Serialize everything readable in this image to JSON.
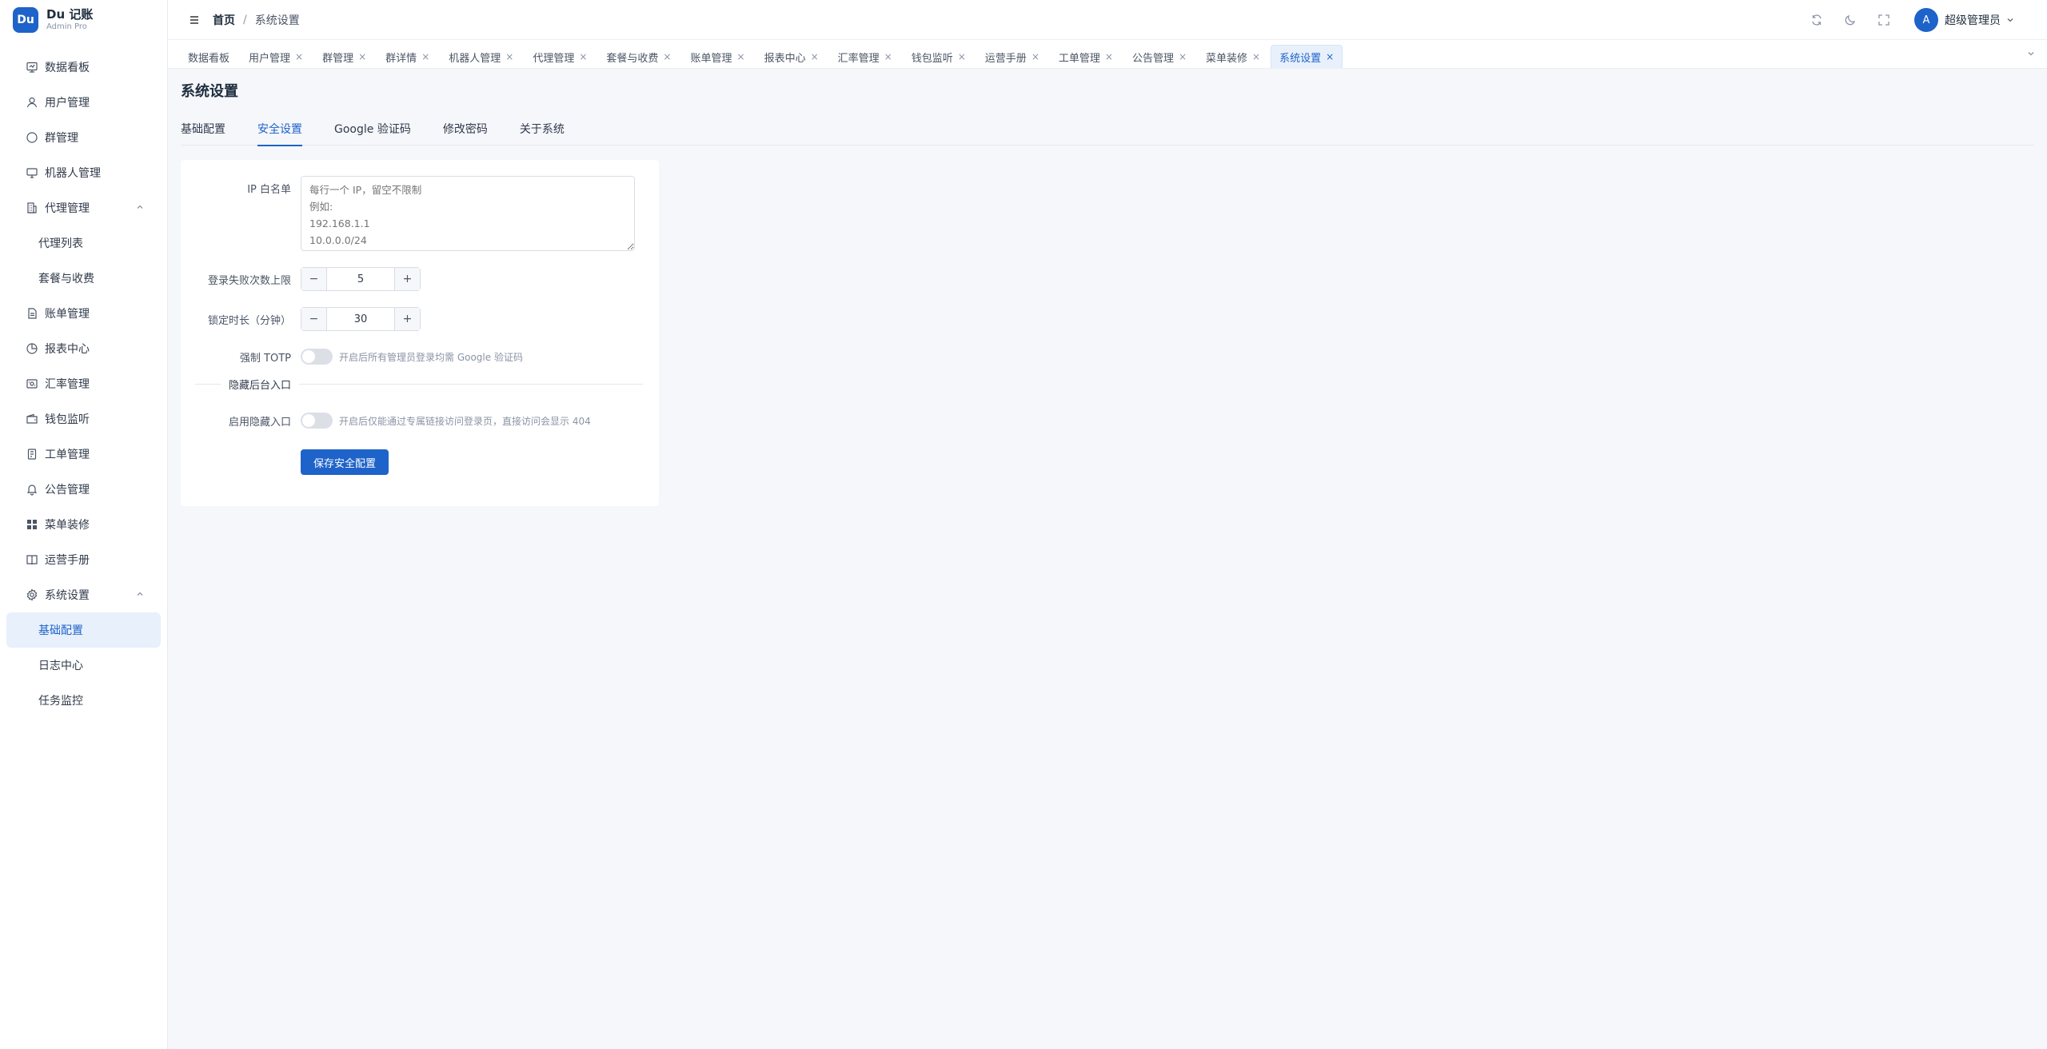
{
  "brand": {
    "logo": "Du",
    "name": "Du 记账",
    "sub": "Admin Pro"
  },
  "sidebar": {
    "items": [
      {
        "label": "数据看板",
        "icon": "dashboard-icon"
      },
      {
        "label": "用户管理",
        "icon": "user-icon"
      },
      {
        "label": "群管理",
        "icon": "chat-icon"
      },
      {
        "label": "机器人管理",
        "icon": "monitor-icon"
      },
      {
        "label": "代理管理",
        "icon": "building-icon",
        "expanded": true
      },
      {
        "label": "代理列表",
        "sub": true
      },
      {
        "label": "套餐与收费",
        "sub": true
      },
      {
        "label": "账单管理",
        "icon": "document-icon"
      },
      {
        "label": "报表中心",
        "icon": "pie-chart-icon"
      },
      {
        "label": "汇率管理",
        "icon": "exchange-icon"
      },
      {
        "label": "钱包监听",
        "icon": "wallet-icon"
      },
      {
        "label": "工单管理",
        "icon": "ticket-icon"
      },
      {
        "label": "公告管理",
        "icon": "bell-icon"
      },
      {
        "label": "菜单装修",
        "icon": "grid-icon"
      },
      {
        "label": "运营手册",
        "icon": "book-icon"
      },
      {
        "label": "系统设置",
        "icon": "gear-icon",
        "expanded": true
      },
      {
        "label": "基础配置",
        "sub": true,
        "active": true
      },
      {
        "label": "日志中心",
        "sub": true
      },
      {
        "label": "任务监控",
        "sub": true
      }
    ]
  },
  "header": {
    "breadcrumb_home": "首页",
    "breadcrumb_sep": "/",
    "breadcrumb_current": "系统设置",
    "avatar_letter": "A",
    "username": "超级管理员"
  },
  "tabs": [
    {
      "label": "数据看板",
      "closable": false
    },
    {
      "label": "用户管理",
      "closable": true
    },
    {
      "label": "群管理",
      "closable": true
    },
    {
      "label": "群详情",
      "closable": true
    },
    {
      "label": "机器人管理",
      "closable": true
    },
    {
      "label": "代理管理",
      "closable": true
    },
    {
      "label": "套餐与收费",
      "closable": true
    },
    {
      "label": "账单管理",
      "closable": true
    },
    {
      "label": "报表中心",
      "closable": true
    },
    {
      "label": "汇率管理",
      "closable": true
    },
    {
      "label": "钱包监听",
      "closable": true
    },
    {
      "label": "运营手册",
      "closable": true
    },
    {
      "label": "工单管理",
      "closable": true
    },
    {
      "label": "公告管理",
      "closable": true
    },
    {
      "label": "菜单装修",
      "closable": true
    },
    {
      "label": "系统设置",
      "closable": true,
      "active": true
    }
  ],
  "main": {
    "title": "系统设置",
    "subtabs": [
      "基础配置",
      "安全设置",
      "Google 验证码",
      "修改密码",
      "关于系统"
    ],
    "active_subtab": 1,
    "form": {
      "ip_label": "IP 白名单",
      "ip_placeholder": "每行一个 IP，留空不限制\n例如:\n192.168.1.1\n10.0.0.0/24",
      "fail_label": "登录失败次数上限",
      "fail_value": "5",
      "lock_label": "锁定时长（分钟）",
      "lock_value": "30",
      "totp_label": "强制 TOTP",
      "totp_hint": "开启后所有管理员登录均需 Google 验证码",
      "totp_on": false,
      "divider_text": "隐藏后台入口",
      "hidden_label": "启用隐藏入口",
      "hidden_hint": "开启后仅能通过专属链接访问登录页，直接访问会显示 404",
      "hidden_on": false,
      "save_label": "保存安全配置"
    }
  },
  "colors": {
    "primary": "#1e63c9",
    "bg": "#f5f7fb",
    "active_bg": "#e8f0fc"
  }
}
